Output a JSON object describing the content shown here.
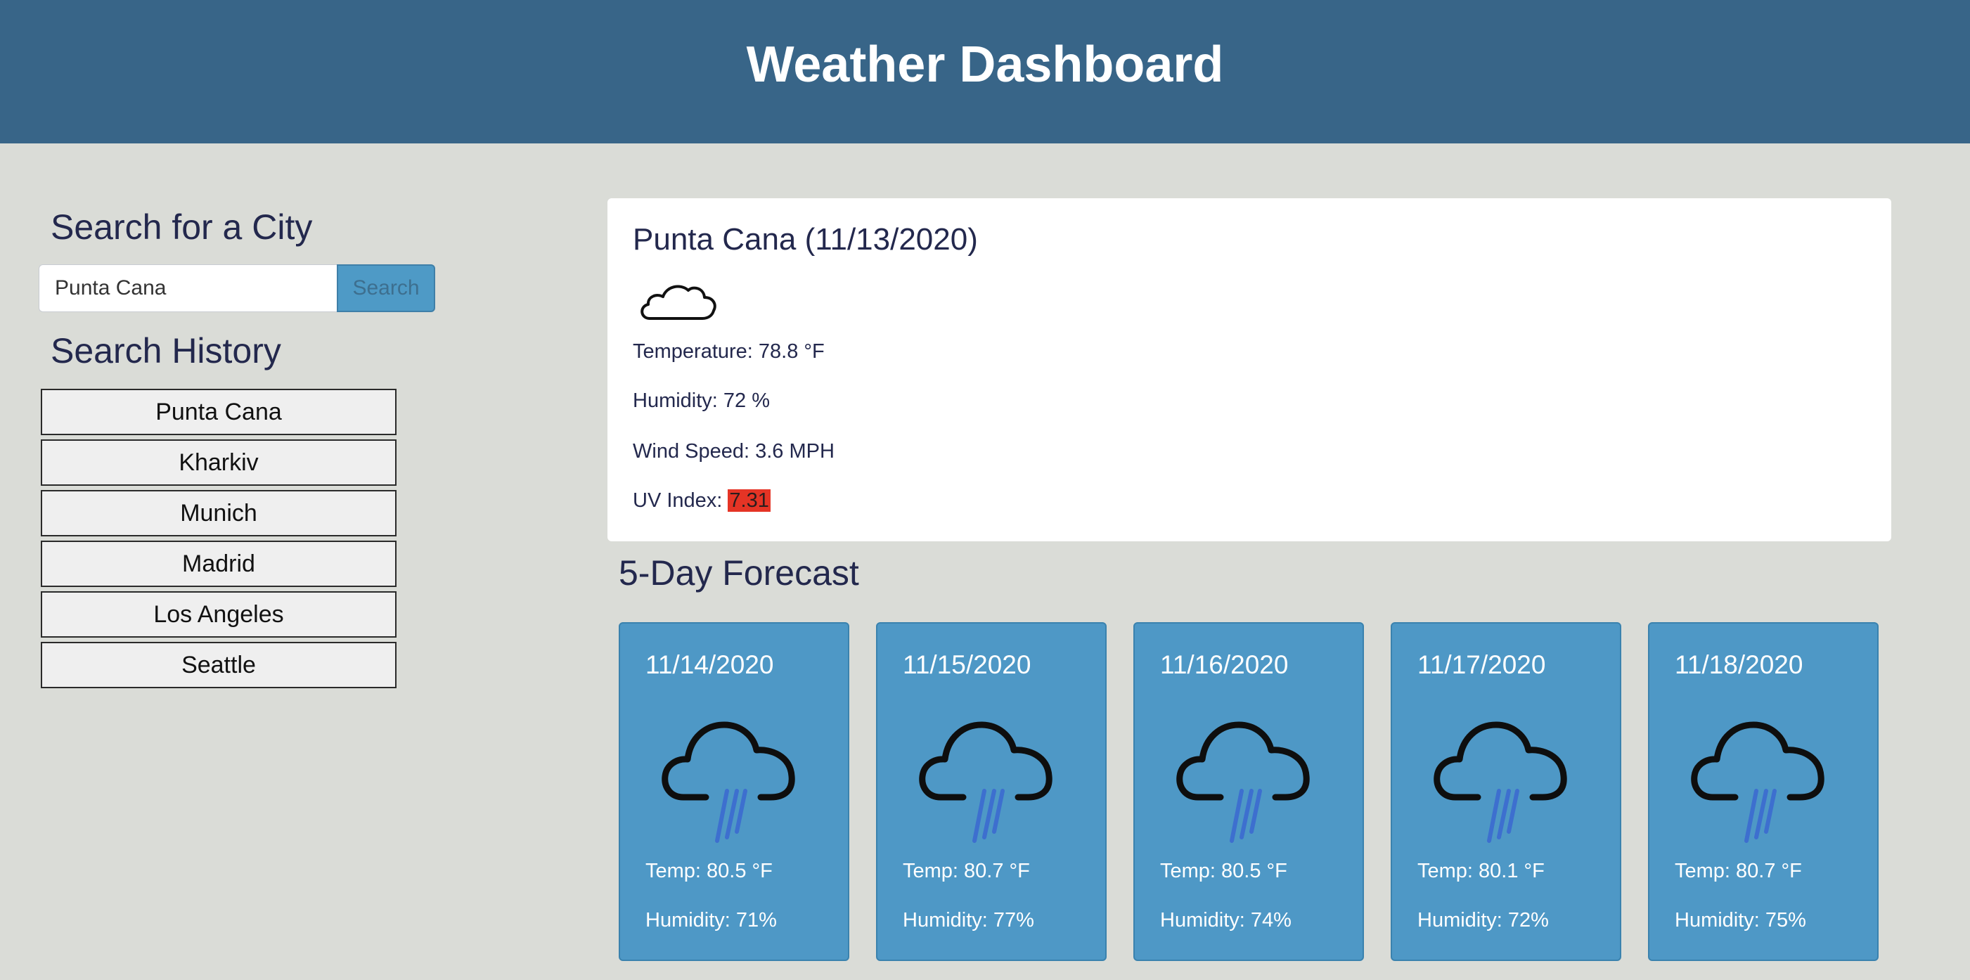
{
  "header": {
    "title": "Weather Dashboard"
  },
  "search": {
    "title": "Search for a City",
    "input_value": "Punta Cana",
    "button_label": "Search"
  },
  "history": {
    "title": "Search History",
    "items": [
      "Punta Cana",
      "Kharkiv",
      "Munich",
      "Madrid",
      "Los Angeles",
      "Seattle"
    ]
  },
  "current": {
    "title": "Punta Cana (11/13/2020)",
    "icon": "cloud-icon",
    "temperature_text": "Temperature: 78.8 °F",
    "humidity_text": "Humidity: 72 %",
    "wind_text": "Wind Speed: 3.6 MPH",
    "uv_label": "UV Index: ",
    "uv_value": "7.31",
    "uv_color": "#e53425"
  },
  "forecast": {
    "title": "5-Day Forecast",
    "icon": "rain-cloud-icon",
    "days": [
      {
        "date": "11/14/2020",
        "temp": "Temp: 80.5 °F",
        "humidity": "Humidity: 71%"
      },
      {
        "date": "11/15/2020",
        "temp": "Temp: 80.7 °F",
        "humidity": "Humidity: 77%"
      },
      {
        "date": "11/16/2020",
        "temp": "Temp: 80.5 °F",
        "humidity": "Humidity: 74%"
      },
      {
        "date": "11/17/2020",
        "temp": "Temp: 80.1 °F",
        "humidity": "Humidity: 72%"
      },
      {
        "date": "11/18/2020",
        "temp": "Temp: 80.7 °F",
        "humidity": "Humidity: 75%"
      }
    ]
  },
  "colors": {
    "header": "#386588",
    "background": "#dadcd7",
    "forecast_card": "#4e98c6",
    "search_button": "#4e9ac6"
  }
}
